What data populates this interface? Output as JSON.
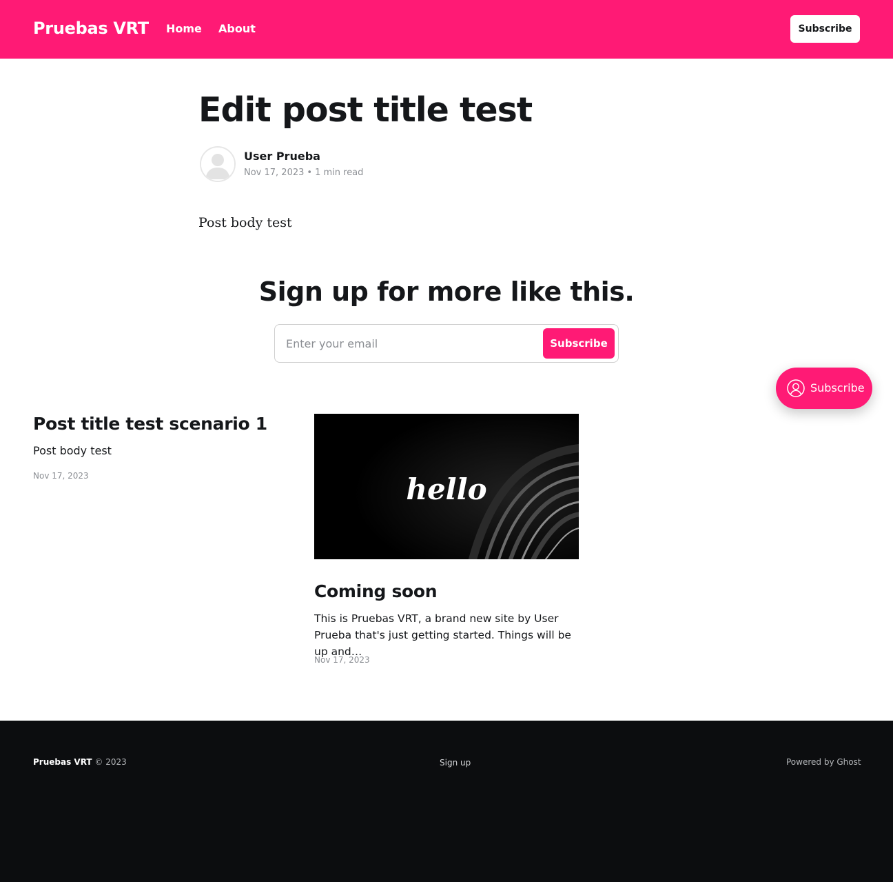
{
  "colors": {
    "accent": "#ff1a75",
    "footer_bg": "#0c0d0f",
    "text": "#15171a",
    "muted": "#8b8e93"
  },
  "header": {
    "site_title": "Pruebas VRT",
    "nav": [
      {
        "label": "Home"
      },
      {
        "label": "About"
      }
    ],
    "subscribe_label": "Subscribe"
  },
  "article": {
    "title": "Edit post title test",
    "author": "User Prueba",
    "avatar_icon": "user-avatar-icon",
    "date": "Nov 17, 2023",
    "separator": "•",
    "reading_time": "1 min read",
    "body": "Post body test"
  },
  "cta": {
    "title": "Sign up for more like this.",
    "email_placeholder": "Enter your email",
    "button_label": "Subscribe"
  },
  "portal": {
    "label": "Subscribe",
    "icon": "user-circle-icon"
  },
  "feed": [
    {
      "title": "Post title test scenario 1",
      "excerpt": "Post body test",
      "date": "Nov 17, 2023"
    },
    {
      "title": "Coming soon",
      "image_text": "hello",
      "excerpt": "This is Pruebas VRT, a brand new site by User Prueba that's just getting started. Things will be up and…",
      "date": "Nov 17, 2023"
    }
  ],
  "footer": {
    "site_name": "Pruebas VRT",
    "copyright": "© 2023",
    "signup_label": "Sign up",
    "powered_by": "Powered by Ghost"
  }
}
